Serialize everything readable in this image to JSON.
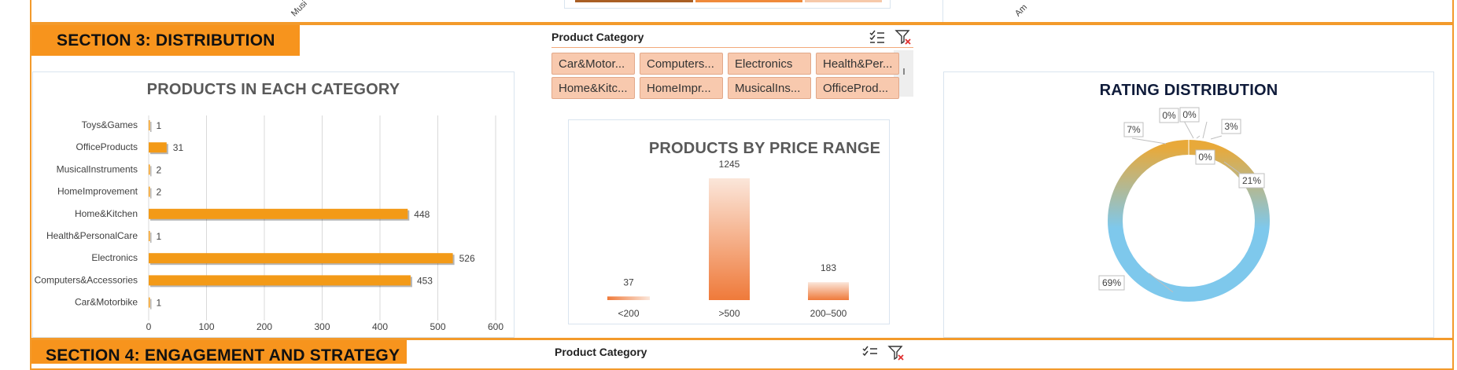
{
  "top_strip": {
    "axis_label_left": "Musi",
    "axis_label_right": "Am"
  },
  "section3": {
    "title": "SECTION 3: DISTRIBUTION"
  },
  "section4": {
    "title": "SECTION 4: ENGAGEMENT AND STRATEGY"
  },
  "slicer_main": {
    "header": "Product Category",
    "items": [
      {
        "label": "Car&Motor..."
      },
      {
        "label": "Computers..."
      },
      {
        "label": "Electronics"
      },
      {
        "label": "Health&Per..."
      },
      {
        "label": "Home&Kitc..."
      },
      {
        "label": "HomeImpr..."
      },
      {
        "label": "MusicalIns..."
      },
      {
        "label": "OfficeProd..."
      }
    ],
    "icons": [
      "multi-select-icon",
      "clear-filter-icon"
    ]
  },
  "slicer_section4": {
    "header": "Product Category"
  },
  "charts": {
    "category": {
      "title": "PRODUCTS IN EACH CATEGORY",
      "tick_labels": [
        "0",
        "100",
        "200",
        "300",
        "400",
        "500",
        "600"
      ],
      "bar_color": "#f39a17"
    },
    "price": {
      "title": "PRODUCTS BY PRICE RANGE",
      "bar_color_dark": "#ef7a3a",
      "bar_color_light": "#fbe6da"
    },
    "rating": {
      "title": "RATING DISTRIBUTION",
      "colors": [
        "#7ec8ec",
        "#e8a93a"
      ]
    }
  },
  "chart_data": [
    {
      "type": "bar",
      "title": "PRODUCTS IN EACH CATEGORY",
      "orientation": "horizontal",
      "categories": [
        "Toys&Games",
        "OfficeProducts",
        "MusicalInstruments",
        "HomeImprovement",
        "Home&Kitchen",
        "Health&PersonalCare",
        "Electronics",
        "Computers&Accessories",
        "Car&Motorbike"
      ],
      "values": [
        1,
        31,
        2,
        2,
        448,
        1,
        526,
        453,
        1
      ],
      "xlim": [
        0,
        600
      ],
      "grid": true,
      "data_labels": true
    },
    {
      "type": "bar",
      "title": "PRODUCTS BY PRICE RANGE",
      "categories": [
        "<200",
        ">500",
        "200–500"
      ],
      "values": [
        37,
        1245,
        183
      ],
      "data_labels": true,
      "grid": false
    },
    {
      "type": "pie",
      "title": "RATING DISTRIBUTION",
      "style": "doughnut",
      "values": [
        69,
        7,
        0,
        0,
        0,
        3,
        21
      ],
      "labels": [
        "69%",
        "7%",
        "0%",
        "0%",
        "0%",
        "3%",
        "21%"
      ]
    }
  ]
}
